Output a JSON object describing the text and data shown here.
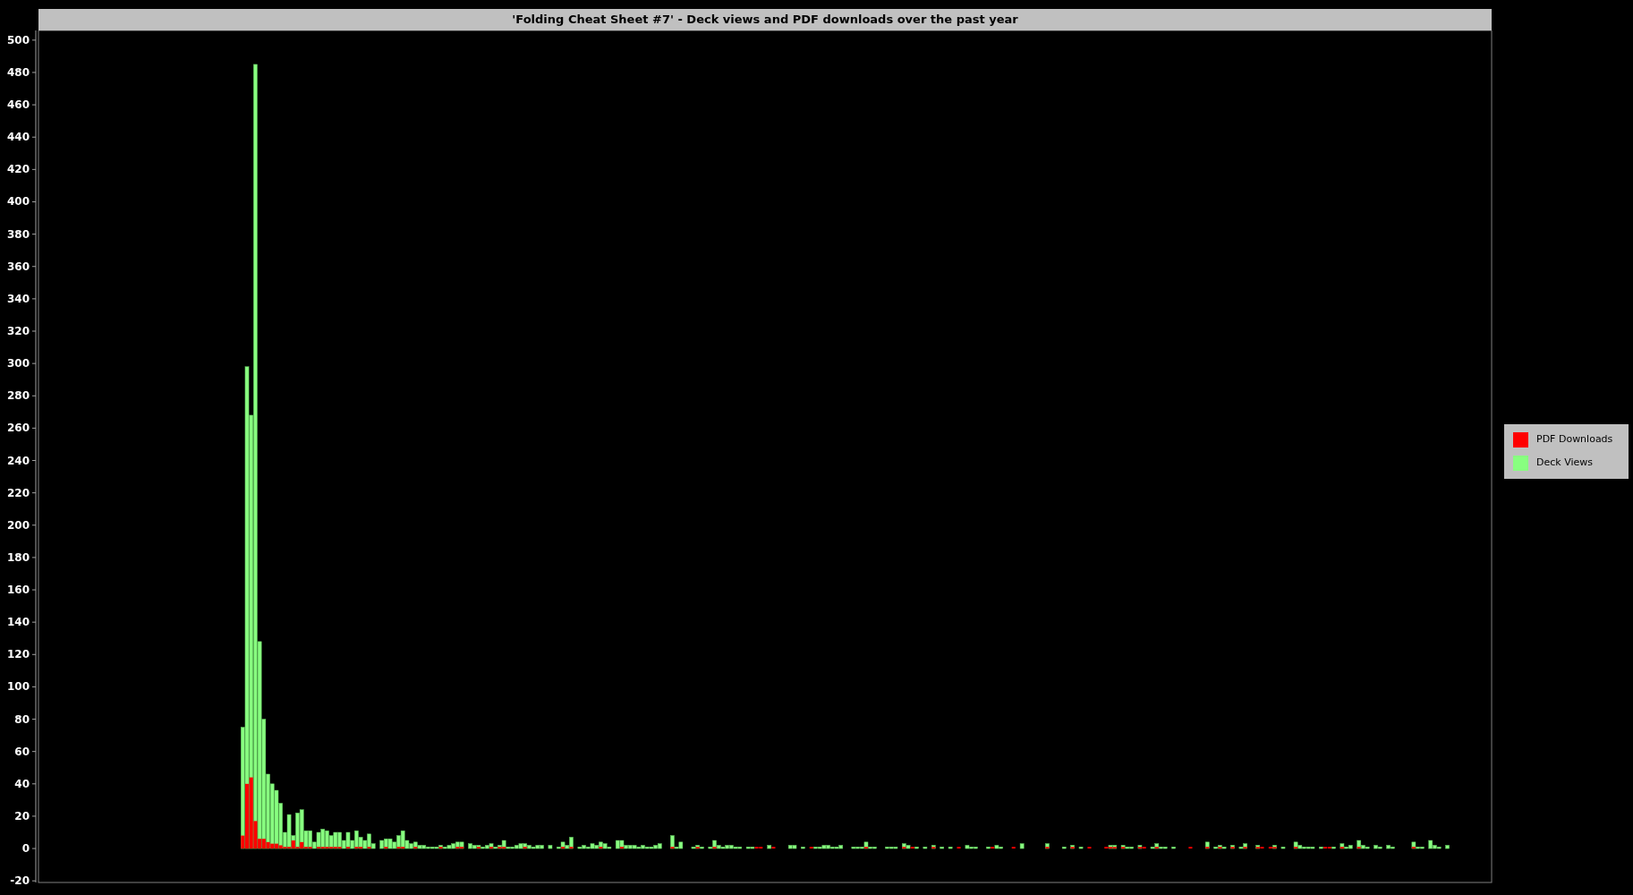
{
  "chart": {
    "title": "'Folding Cheat Sheet #7' - Deck views and PDF downloads over the past year",
    "y_axis_labels": [
      "500",
      "480",
      "460",
      "440",
      "420",
      "400",
      "380",
      "360",
      "340",
      "320",
      "300",
      "280",
      "260",
      "240",
      "220",
      "200",
      "180",
      "160",
      "140",
      "120",
      "100",
      "80",
      "60",
      "40",
      "20",
      "0",
      "-20"
    ],
    "legend": [
      {
        "label": "PDF Downloads",
        "color": "#ff0000"
      },
      {
        "label": "Deck Views",
        "color": "#88ff80"
      }
    ]
  }
}
